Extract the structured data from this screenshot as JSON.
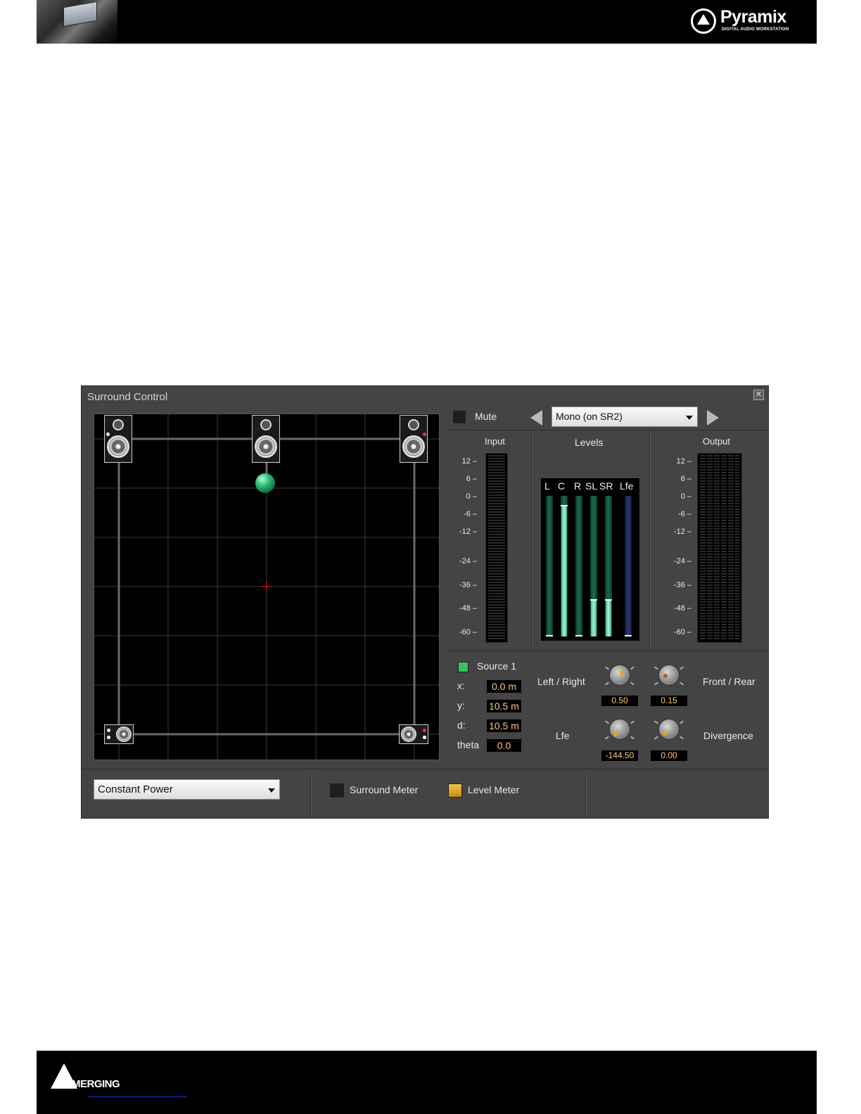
{
  "header": {
    "brand": "Pyramix",
    "brand_tagline": "DIGITAL AUDIO WORKSTATION",
    "logo_icon": "pyramix-triangle-logo"
  },
  "footer": {
    "brand": "MERGING"
  },
  "window": {
    "title": "Surround Control",
    "close_glyph": "✕",
    "mute_label": "Mute",
    "routing_value": "Mono (on SR2)",
    "meters": {
      "input_title": "Input",
      "levels_title": "Levels",
      "output_title": "Output",
      "scale": [
        "12 –",
        "6 –",
        "0 –",
        "-6 –",
        "-12 –",
        "-24 –",
        "-36 –",
        "-48 –",
        "-60 –"
      ],
      "channels": [
        {
          "name": "L",
          "level": 0.0,
          "peak": 0.0
        },
        {
          "name": "C",
          "level": 0.93,
          "peak": 0.93
        },
        {
          "name": "R",
          "level": 0.0,
          "peak": 0.0
        },
        {
          "name": "SL",
          "level": 0.26,
          "peak": 0.26
        },
        {
          "name": "SR",
          "level": 0.26,
          "peak": 0.26
        },
        {
          "name": "Lfe",
          "level": 0.0,
          "peak": 0.0
        }
      ]
    },
    "source": {
      "label": "Source 1",
      "x_label": "x:",
      "x_value": "0.0 m",
      "y_label": "y:",
      "y_value": "10.5 m",
      "d_label": "d:",
      "d_value": "10.5 m",
      "theta_label": "theta",
      "theta_value": "0.0"
    },
    "knobs": {
      "left_right_label": "Left / Right",
      "left_right_value": "0.50",
      "front_rear_label": "Front / Rear",
      "front_rear_value": "0.15",
      "lfe_label": "Lfe",
      "lfe_value": "-144.50",
      "divergence_label": "Divergence",
      "divergence_value": "0.00"
    },
    "pan_law_value": "Constant Power",
    "surround_meter_label": "Surround Meter",
    "level_meter_label": "Level Meter",
    "colors": {
      "source_led": "#39c060",
      "level_meter_check": "#e0a820",
      "source_ball": "#2fc27c",
      "center_cross": "#ff2020"
    }
  }
}
